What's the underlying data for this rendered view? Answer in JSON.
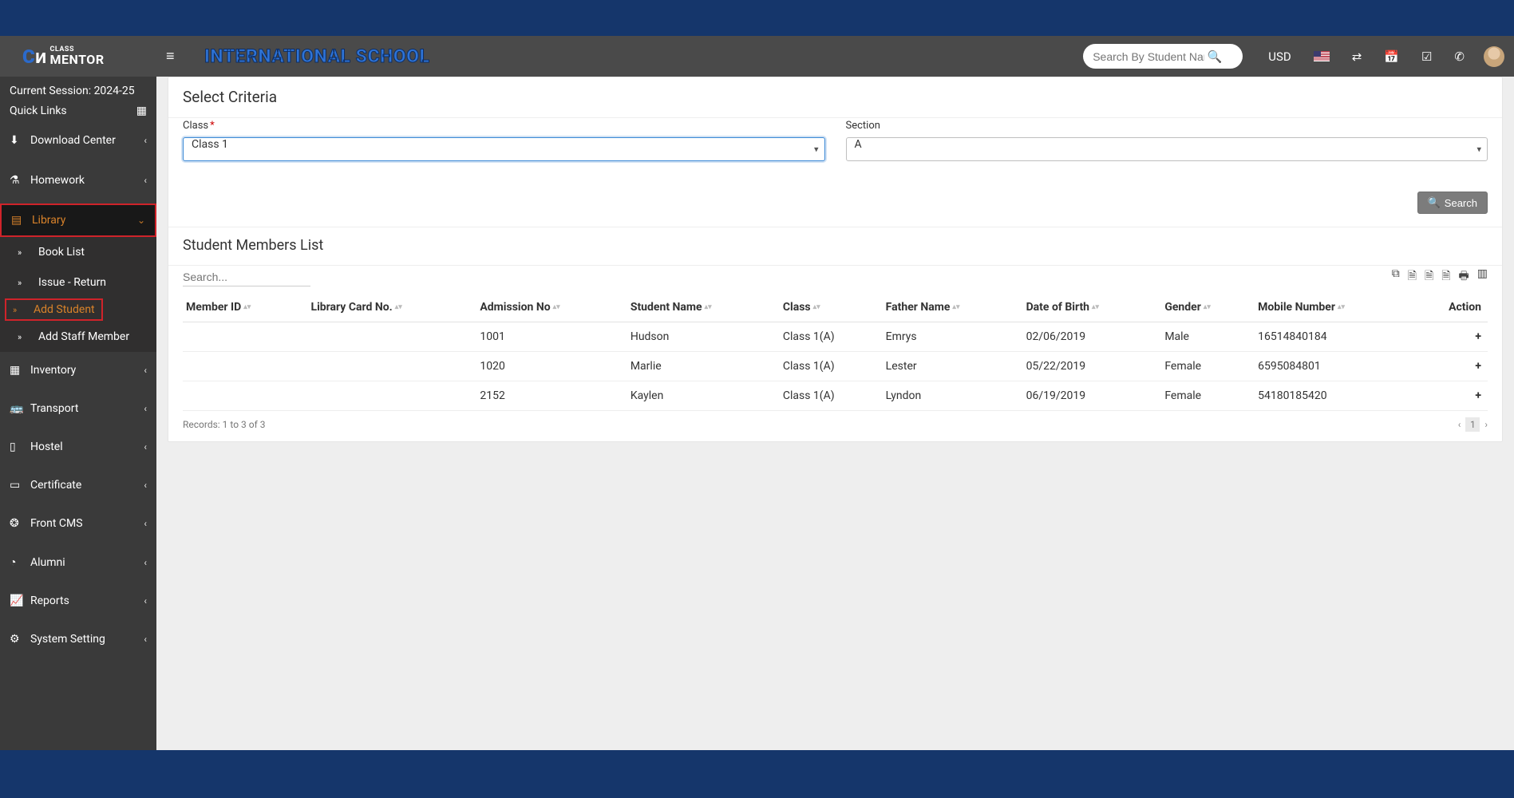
{
  "brand": {
    "small": "CLASS",
    "big": "MENTOR"
  },
  "app_title": "INTERNATIONAL SCHOOL",
  "header": {
    "search_placeholder": "Search By Student Name",
    "currency": "USD"
  },
  "sidebar": {
    "session": "Current Session: 2024-25",
    "quick_links": "Quick Links",
    "items": [
      {
        "label": "Download Center",
        "icon": "⬇"
      },
      {
        "label": "Homework",
        "icon": "⚗"
      },
      {
        "label": "Library",
        "icon": "▤"
      },
      {
        "label": "Inventory",
        "icon": "▦"
      },
      {
        "label": "Transport",
        "icon": "🚌"
      },
      {
        "label": "Hostel",
        "icon": "▯"
      },
      {
        "label": "Certificate",
        "icon": "▭"
      },
      {
        "label": "Front CMS",
        "icon": "❂"
      },
      {
        "label": "Alumni",
        "icon": "◔"
      },
      {
        "label": "Reports",
        "icon": "📈"
      },
      {
        "label": "System Setting",
        "icon": "⚙"
      }
    ],
    "library_sub": [
      {
        "label": "Book List"
      },
      {
        "label": "Issue - Return"
      },
      {
        "label": "Add Student"
      },
      {
        "label": "Add Staff Member"
      }
    ]
  },
  "criteria": {
    "title": "Select Criteria",
    "class_label": "Class",
    "section_label": "Section",
    "class_value": "Class 1",
    "section_value": "A",
    "search_btn": "Search"
  },
  "list": {
    "title": "Student Members List",
    "search_placeholder": "Search...",
    "columns": [
      "Member ID",
      "Library Card No.",
      "Admission No",
      "Student Name",
      "Class",
      "Father Name",
      "Date of Birth",
      "Gender",
      "Mobile Number",
      "Action"
    ],
    "rows": [
      {
        "member_id": "",
        "card_no": "",
        "admission": "1001",
        "name": "Hudson",
        "class": "Class 1(A)",
        "father": "Emrys",
        "dob": "02/06/2019",
        "gender": "Male",
        "mobile": "16514840184"
      },
      {
        "member_id": "",
        "card_no": "",
        "admission": "1020",
        "name": "Marlie",
        "class": "Class 1(A)",
        "father": "Lester",
        "dob": "05/22/2019",
        "gender": "Female",
        "mobile": "6595084801"
      },
      {
        "member_id": "",
        "card_no": "",
        "admission": "2152",
        "name": "Kaylen",
        "class": "Class 1(A)",
        "father": "Lyndon",
        "dob": "06/19/2019",
        "gender": "Female",
        "mobile": "54180185420"
      }
    ],
    "records_label": "Records: 1 to 3 of 3",
    "page": "1"
  }
}
